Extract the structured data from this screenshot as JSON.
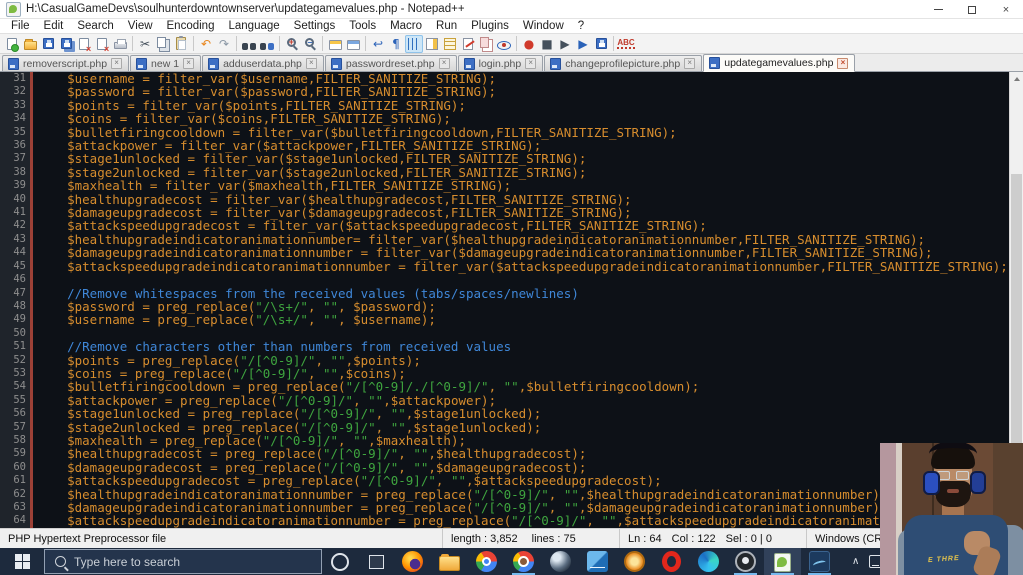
{
  "window": {
    "title": "H:\\CasualGameDevs\\soulhunterdowntownserver\\updategamevalues.php - Notepad++",
    "controls": [
      {
        "name": "minimize-button"
      },
      {
        "name": "maximize-button"
      },
      {
        "name": "close-button",
        "glyph": "×"
      }
    ]
  },
  "menu": {
    "items": [
      "File",
      "Edit",
      "Search",
      "View",
      "Encoding",
      "Language",
      "Settings",
      "Tools",
      "Macro",
      "Run",
      "Plugins",
      "Window",
      "?"
    ]
  },
  "toolbar": {
    "icons": [
      {
        "name": "new-file-icon",
        "k": "doc dg"
      },
      {
        "name": "open-file-icon",
        "k": "folder"
      },
      {
        "name": "save-icon",
        "k": "floppy"
      },
      {
        "name": "save-all-icon",
        "k": "floppy all"
      },
      {
        "name": "close-icon",
        "k": "doc dr"
      },
      {
        "name": "close-all-icon",
        "k": "doc dr"
      },
      {
        "name": "print-icon",
        "k": "printer"
      },
      {
        "sep": true
      },
      {
        "name": "cut-icon",
        "glyph": "✂",
        "color": "#45505c"
      },
      {
        "name": "copy-icon",
        "k": "copy"
      },
      {
        "name": "paste-icon",
        "k": "clip"
      },
      {
        "sep": true
      },
      {
        "name": "undo-icon",
        "glyph": "↶",
        "color": "#e8851c"
      },
      {
        "name": "redo-icon",
        "glyph": "↷",
        "color": "#8a97a5"
      },
      {
        "sep": true
      },
      {
        "name": "find-icon",
        "k": "binoc"
      },
      {
        "name": "replace-icon",
        "k": "binoc rep"
      },
      {
        "sep": true
      },
      {
        "name": "zoom-in-icon",
        "k": "zoom zi"
      },
      {
        "name": "zoom-out-icon",
        "k": "zoom zo"
      },
      {
        "sep": true
      },
      {
        "name": "sync-vertical-icon",
        "k": "win"
      },
      {
        "name": "sync-horizontal-icon",
        "k": "win w2"
      },
      {
        "sep": true
      },
      {
        "name": "word-wrap-icon",
        "glyph": "↩",
        "color": "#2a62b8"
      },
      {
        "name": "show-all-characters-icon",
        "glyph": "¶",
        "color": "#2a62b8"
      },
      {
        "name": "indent-guide-icon",
        "k": "indent",
        "pressed": true
      },
      {
        "name": "document-map-icon",
        "k": "docmap"
      },
      {
        "name": "function-list-icon",
        "k": "funclist"
      },
      {
        "name": "modified-doc-icon",
        "k": "pen"
      },
      {
        "name": "folder-workspace-icon",
        "k": "pink"
      },
      {
        "name": "monitoring-icon",
        "k": "eye"
      },
      {
        "sep": true
      },
      {
        "name": "macro-record-icon",
        "glyph": "●",
        "color": "#d03a2b"
      },
      {
        "name": "macro-stop-icon",
        "glyph": "■",
        "color": "#45505c"
      },
      {
        "name": "macro-play-icon",
        "glyph": "▶",
        "color": "#45505c"
      },
      {
        "name": "macro-run-multiple-icon",
        "glyph": "▶",
        "color": "#2a62b8"
      },
      {
        "name": "macro-save-icon",
        "k": "floppy"
      },
      {
        "sep": true
      },
      {
        "name": "spellcheck-icon",
        "k": "abc",
        "text": "ABC"
      }
    ]
  },
  "tabs": {
    "close_glyph": "×",
    "items": [
      {
        "label": "removerscript.php",
        "active": false
      },
      {
        "label": "new 1",
        "active": false
      },
      {
        "label": "adduserdata.php",
        "active": false
      },
      {
        "label": "passwordreset.php",
        "active": false
      },
      {
        "label": "login.php",
        "active": false
      },
      {
        "label": "changeprofilepicture.php",
        "active": false
      },
      {
        "label": "updategamevalues.php",
        "active": true
      }
    ]
  },
  "editor": {
    "first_line": 31,
    "colors": {
      "default": "#d78d2e",
      "string": "#3fa63f",
      "comment": "#3f87d8",
      "background": "#0d1117",
      "gutter": "#1f242b",
      "change_marker": "#9c4137"
    },
    "lines": [
      "    $username = filter_var($username,FILTER_SANITIZE_STRING);",
      "    $password = filter_var($password,FILTER_SANITIZE_STRING);",
      "    $points = filter_var($points,FILTER_SANITIZE_STRING);",
      "    $coins = filter_var($coins,FILTER_SANITIZE_STRING);",
      "    $bulletfiringcooldown = filter_var($bulletfiringcooldown,FILTER_SANITIZE_STRING);",
      "    $attackpower = filter_var($attackpower,FILTER_SANITIZE_STRING);",
      "    $stage1unlocked = filter_var($stage1unlocked,FILTER_SANITIZE_STRING);",
      "    $stage2unlocked = filter_var($stage2unlocked,FILTER_SANITIZE_STRING);",
      "    $maxhealth = filter_var($maxhealth,FILTER_SANITIZE_STRING);",
      "    $healthupgradecost = filter_var($healthupgradecost,FILTER_SANITIZE_STRING);",
      "    $damageupgradecost = filter_var($damageupgradecost,FILTER_SANITIZE_STRING);",
      "    $attackspeedupgradecost = filter_var($attackspeedupgradecost,FILTER_SANITIZE_STRING);",
      "    $healthupgradeindicatoranimationnumber= filter_var($healthupgradeindicatoranimationnumber,FILTER_SANITIZE_STRING);",
      "    $damageupgradeindicatoranimationnumber = filter_var($damageupgradeindicatoranimationnumber,FILTER_SANITIZE_STRING);",
      "    $attackspeedupgradeindicatoranimationnumber = filter_var($attackspeedupgradeindicatoranimationnumber,FILTER_SANITIZE_STRING);",
      "",
      "    //Remove whitespaces from the received values (tabs/spaces/newlines)",
      "    $password = preg_replace(\"/\\s+/\", \"\", $password);",
      "    $username = preg_replace(\"/\\s+/\", \"\", $username);",
      "",
      "    //Remove characters other than numbers from received values",
      "    $points = preg_replace(\"/[^0-9]/\", \"\",$points);",
      "    $coins = preg_replace(\"/[^0-9]/\", \"\",$coins);",
      "    $bulletfiringcooldown = preg_replace(\"/[^0-9]/./[^0-9]/\", \"\",$bulletfiringcooldown);",
      "    $attackpower = preg_replace(\"/[^0-9]/\", \"\",$attackpower);",
      "    $stage1unlocked = preg_replace(\"/[^0-9]/\", \"\",$stage1unlocked);",
      "    $stage2unlocked = preg_replace(\"/[^0-9]/\", \"\",$stage1unlocked);",
      "    $maxhealth = preg_replace(\"/[^0-9]/\", \"\",$maxhealth);",
      "    $healthupgradecost = preg_replace(\"/[^0-9]/\", \"\",$healthupgradecost);",
      "    $damageupgradecost = preg_replace(\"/[^0-9]/\", \"\",$damageupgradecost);",
      "    $attackspeedupgradecost = preg_replace(\"/[^0-9]/\", \"\",$attackspeedupgradecost);",
      "    $healthupgradeindicatoranimationnumber = preg_replace(\"/[^0-9]/\", \"\",$healthupgradeindicatoranimationnumber);",
      "    $damageupgradeindicatoranimationnumber = preg_replace(\"/[^0-9]/\", \"\",$damageupgradeindicatoranimationnumber);",
      "    $attackspeedupgradeindicatoranimationnumber = preg_replace(\"/[^0-9]/\", \"\",$attackspeedupgradeindicatoranimationnumber);"
    ]
  },
  "status_bar": {
    "doc_type": "PHP Hypertext Preprocessor file",
    "length_label": "length : 3,852",
    "lines_label": "lines : 75",
    "ln": "Ln : 64",
    "col": "Col : 122",
    "sel": "Sel : 0 | 0",
    "eol": "Windows (CR LF)"
  },
  "taskbar": {
    "search_text": "Type here to search",
    "apps": [
      {
        "name": "taskbar-firefox-icon",
        "k": "firefox"
      },
      {
        "name": "taskbar-explorer-icon",
        "k": "explorer"
      },
      {
        "name": "taskbar-chrome-icon",
        "k": "chrome"
      },
      {
        "name": "taskbar-chrome-profile-icon",
        "k": "chrome2",
        "running": true
      },
      {
        "name": "taskbar-steam-icon",
        "k": "sphere"
      },
      {
        "name": "taskbar-blue-app-icon",
        "k": "blueapp"
      },
      {
        "name": "taskbar-xnview-icon",
        "k": "xnview"
      },
      {
        "name": "taskbar-opera-icon",
        "k": "opera"
      },
      {
        "name": "taskbar-edge-icon",
        "k": "edge"
      },
      {
        "name": "taskbar-obs-icon",
        "k": "obs",
        "running": true
      },
      {
        "name": "taskbar-notepadpp-icon",
        "k": "npp",
        "running": true,
        "active": true
      },
      {
        "name": "taskbar-vector-app-icon",
        "k": "curves",
        "running": true
      }
    ]
  },
  "webcam": {
    "shirt_text": "E THRE"
  }
}
